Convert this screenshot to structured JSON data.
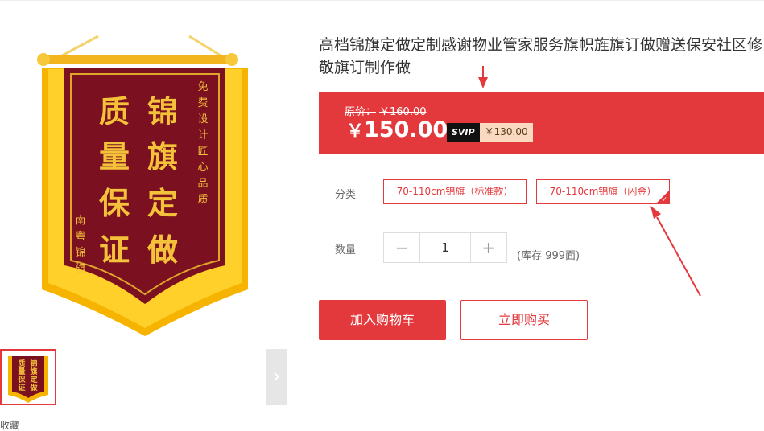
{
  "product": {
    "title": "高档锦旗定做定制感谢物业管家服务旗帜旌旗订做赠送保安社区修敬旗订制作做"
  },
  "gallery": {
    "next_arrow": "›",
    "banner_main_text": [
      "锦旗定做",
      "质量保证"
    ],
    "banner_side_text": "免费设计匠心品质",
    "banner_maker_text": "南粤锦旗",
    "cut_off_text": "收藏"
  },
  "price": {
    "original_label": "原价：",
    "original_value": "￥160.00",
    "currency_symbol": "￥",
    "current_value": "150.00",
    "svip_badge": "SVIP",
    "svip_price": "￥130.00"
  },
  "options": {
    "label": "分类",
    "items": [
      {
        "label": "70-110cm锦旗（标准款）",
        "selected": false
      },
      {
        "label": "70-110cm锦旗（闪金）",
        "selected": true
      }
    ],
    "check": "✓"
  },
  "quantity": {
    "label": "数量",
    "minus": "−",
    "value": "1",
    "plus": "+",
    "stock": "(库存 999面)"
  },
  "actions": {
    "add_to_cart": "加入购物车",
    "buy_now": "立即购买"
  },
  "colors": {
    "accent": "#e4393c",
    "banner_fabric": "#7a1020",
    "banner_gold": "#f0c419"
  }
}
